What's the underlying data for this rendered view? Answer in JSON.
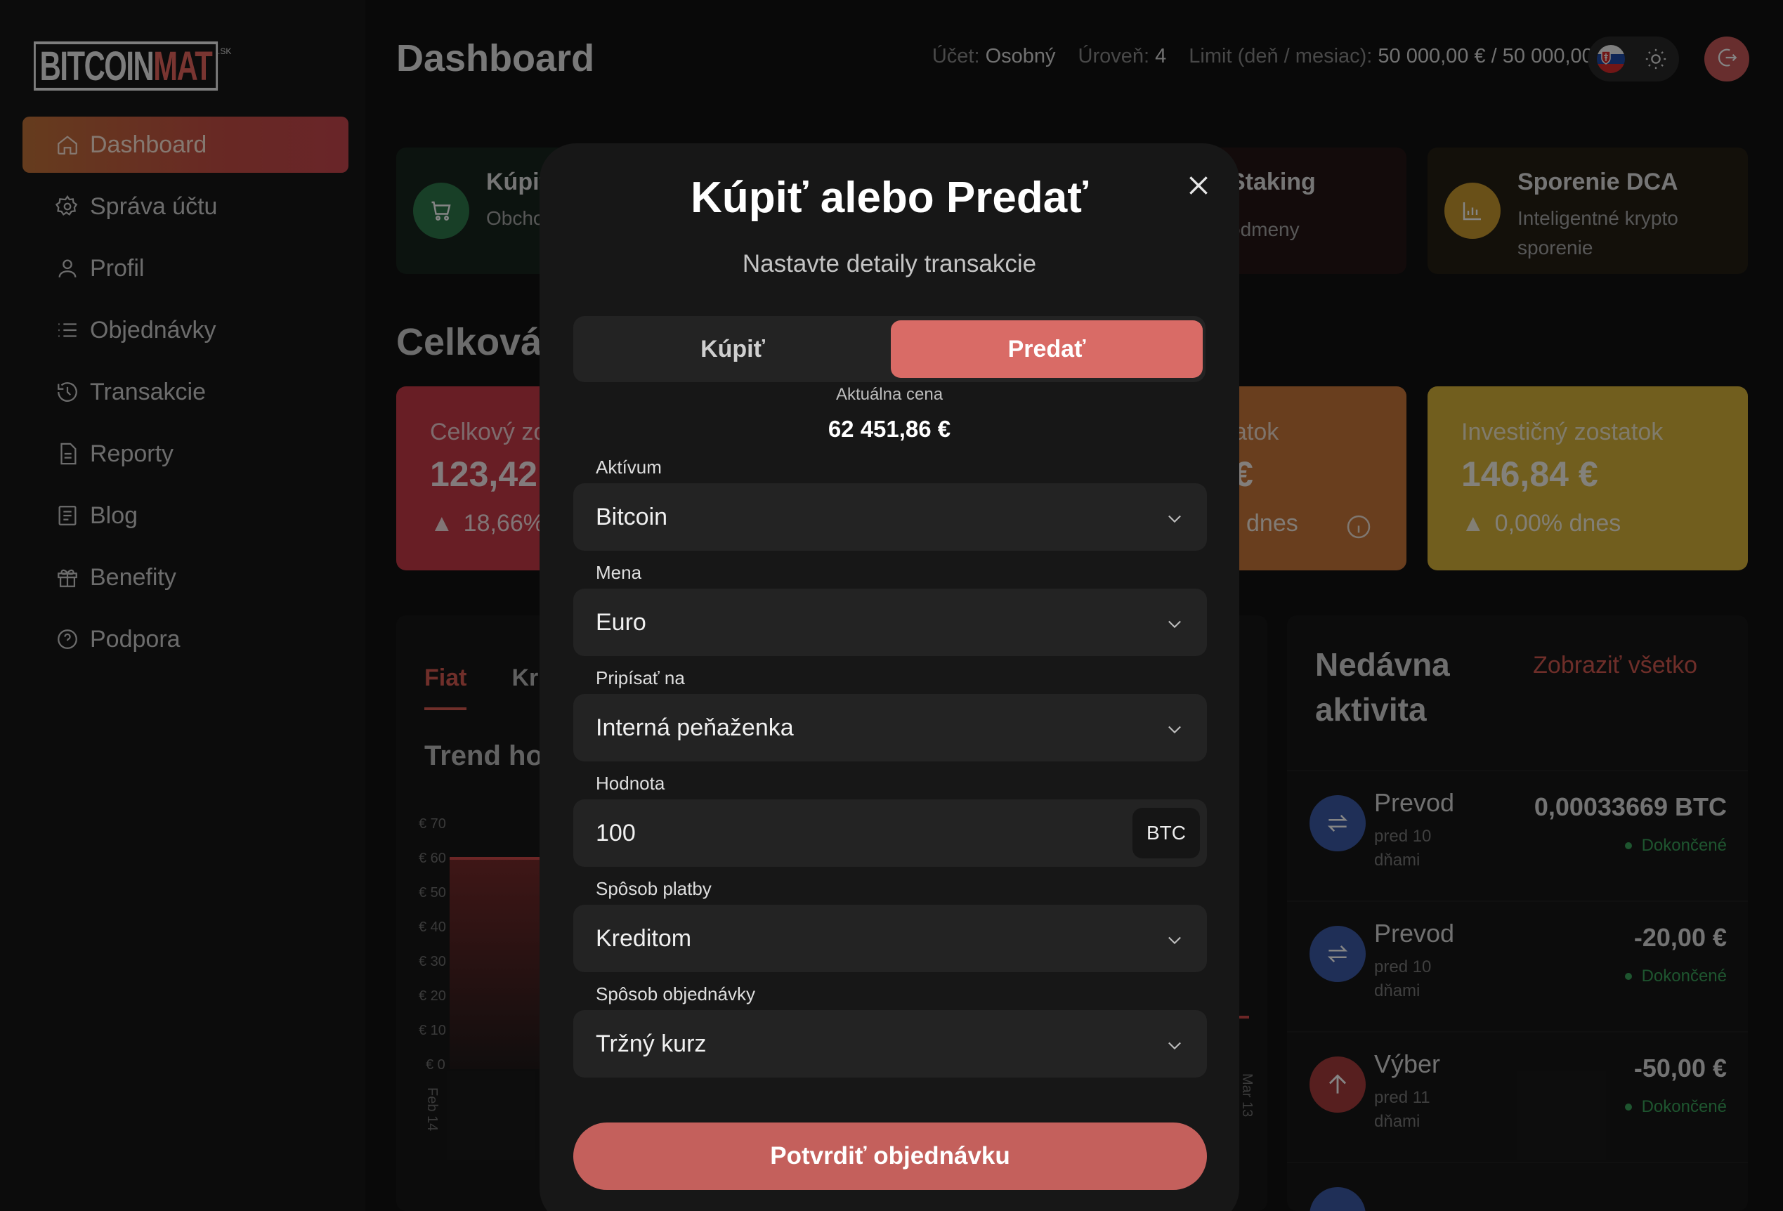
{
  "brand": {
    "logo_main": "BITCOIN",
    "logo_accent": "MAT",
    "logo_suffix": ".SK"
  },
  "sidebar": {
    "items": [
      {
        "label": "Dashboard",
        "icon": "home-icon"
      },
      {
        "label": "Správa účtu",
        "icon": "gear-icon"
      },
      {
        "label": "Profil",
        "icon": "user-icon"
      },
      {
        "label": "Objednávky",
        "icon": "list-icon"
      },
      {
        "label": "Transakcie",
        "icon": "history-icon"
      },
      {
        "label": "Reporty",
        "icon": "document-icon"
      },
      {
        "label": "Blog",
        "icon": "blog-icon"
      },
      {
        "label": "Benefity",
        "icon": "gift-icon"
      },
      {
        "label": "Podpora",
        "icon": "help-icon"
      }
    ]
  },
  "header": {
    "title": "Dashboard",
    "account_label": "Účet:",
    "account_value": "Osobný",
    "level_label": "Úroveň:",
    "level_value": "4",
    "limit_label": "Limit (deň / mesiac):",
    "limit_value": "50 000,00 € / 50 000,00 €"
  },
  "quick_cards": [
    {
      "title": "Kúpiť",
      "desc": "Obchodujte krypto"
    },
    {
      "title": "Staking",
      "desc": "odmeny"
    },
    {
      "title": "Sporenie DCA",
      "desc": "Inteligentné krypto sporenie"
    }
  ],
  "overview": {
    "title": "Celková",
    "total_label": "Celkový zo",
    "total_value": "123,42",
    "total_change": "18,66%",
    "middle_label": "atok",
    "middle_value": "€",
    "middle_change": "dnes",
    "invest_label": "Investičný zostatok",
    "invest_value": "146,84 €",
    "invest_change": "0,00% dnes"
  },
  "chart_panel": {
    "tabs": [
      "Fiat",
      "Kr"
    ],
    "trend_title": "Trend ho",
    "y_ticks": [
      "€ 70",
      "€ 60",
      "€ 50",
      "€ 40",
      "€ 30",
      "€ 20",
      "€ 10",
      "€ 0"
    ],
    "x_start": "Feb 14",
    "x_end": "Mar 13"
  },
  "activity": {
    "title": "Nedávna aktivita",
    "show_all": "Zobraziť všetko",
    "rows": [
      {
        "name": "Prevod",
        "time": "pred 10 dňami",
        "amount": "0,00033669 BTC",
        "status": "Dokončené",
        "icon": "transfer-icon",
        "color": "#3d5aa8"
      },
      {
        "name": "Prevod",
        "time": "pred 10 dňami",
        "amount": "-20,00 €",
        "status": "Dokončené",
        "icon": "transfer-icon",
        "color": "#3d5aa8"
      },
      {
        "name": "Výber",
        "time": "pred 11 dňami",
        "amount": "-50,00 €",
        "status": "Dokončené",
        "icon": "arrow-up-icon",
        "color": "#a83c3c"
      }
    ]
  },
  "modal": {
    "title": "Kúpiť alebo Predať",
    "subtitle": "Nastavte detaily transakcie",
    "buy_label": "Kúpiť",
    "sell_label": "Predať",
    "selected_tab": "Predať",
    "price_label": "Aktuálna cena",
    "price_value": "62 451,86 €",
    "asset_label": "Aktívum",
    "asset_value": "Bitcoin",
    "currency_label": "Mena",
    "currency_value": "Euro",
    "credit_label": "Pripísať na",
    "credit_value": "Interná peňaženka",
    "amount_label": "Hodnota",
    "amount_value": "100",
    "amount_unit": "BTC",
    "payment_label": "Spôsob platby",
    "payment_value": "Kreditom",
    "order_label": "Spôsob objednávky",
    "order_value": "Tržný kurz",
    "confirm_label": "Potvrdiť objednávku"
  },
  "colors": {
    "accent": "#d96b66",
    "confirm": "#c4605c",
    "success": "#3aa35a"
  }
}
